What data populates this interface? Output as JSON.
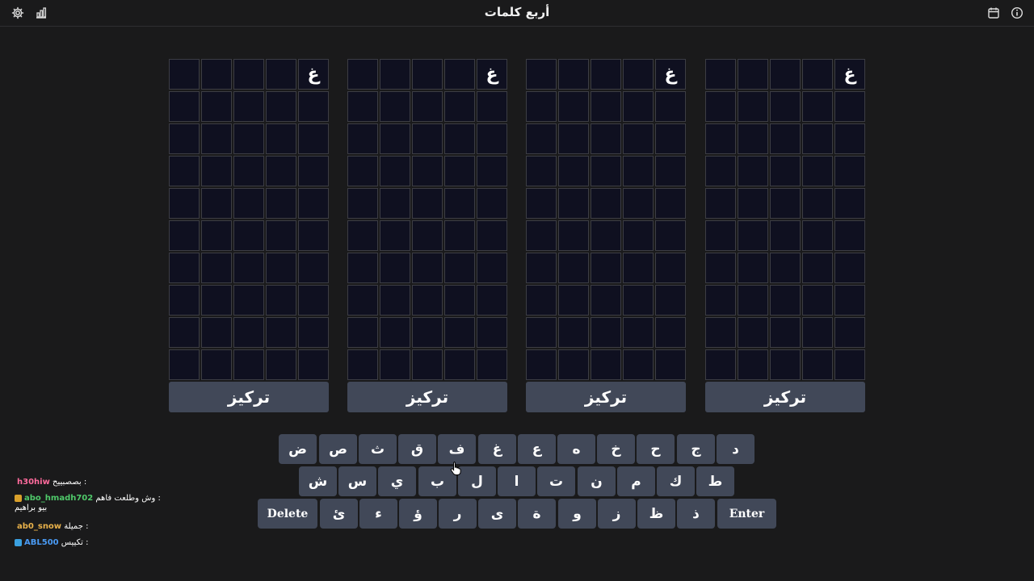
{
  "header": {
    "title": "أربع كلمات",
    "icons": [
      "gear-icon",
      "bar-chart-icon",
      "calendar-icon",
      "info-icon"
    ]
  },
  "boards": [
    {
      "first_row_letter": "غ",
      "focus_label": "تركيز"
    },
    {
      "first_row_letter": "غ",
      "focus_label": "تركيز"
    },
    {
      "first_row_letter": "غ",
      "focus_label": "تركيز"
    },
    {
      "first_row_letter": "غ",
      "focus_label": "تركيز"
    }
  ],
  "keyboard": {
    "row1": [
      "ض",
      "ص",
      "ث",
      "ق",
      "ف",
      "غ",
      "ع",
      "ه",
      "خ",
      "ح",
      "ج",
      "د"
    ],
    "row2": [
      "ش",
      "س",
      "ي",
      "ب",
      "ل",
      "ا",
      "ت",
      "ن",
      "م",
      "ك",
      "ط"
    ],
    "row3": [
      "Delete",
      "ئ",
      "ء",
      "ؤ",
      "ر",
      "ى",
      "ة",
      "و",
      "ز",
      "ظ",
      "ذ",
      "Enter"
    ]
  },
  "chat": [
    {
      "user": "h30hiw",
      "text": "بصصبييح :",
      "user_color": "#ff6b9d",
      "badge": ""
    },
    {
      "user": "abo_hmadh702",
      "text": "وش وطلعت فاهم :",
      "text2": "بيو براهيم",
      "user_color": "#4fc96a",
      "badge": "#d9a02b"
    },
    {
      "user": "ab0_snow",
      "text": "جميلة :",
      "user_color": "#e8b14a",
      "badge": ""
    },
    {
      "user": "ABL500",
      "text": "تكييس :",
      "user_color": "#4a9bf5",
      "badge": "#3aa0e0"
    }
  ]
}
